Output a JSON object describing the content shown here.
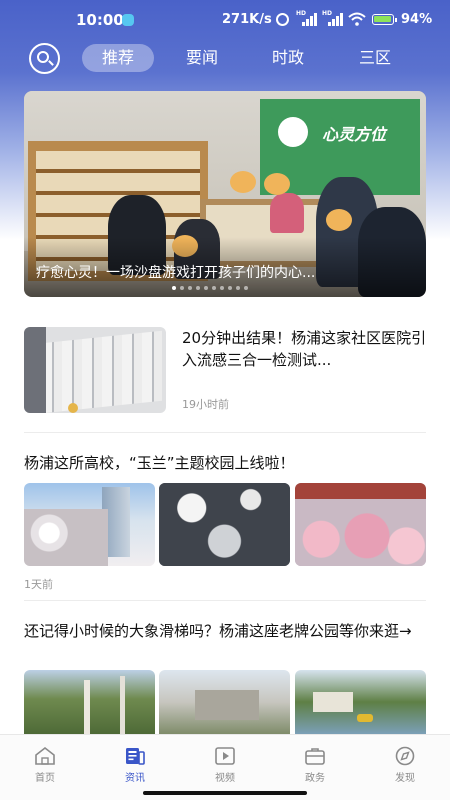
{
  "status_bar": {
    "time": "10:00",
    "network_speed": "271K/s",
    "battery_percent": "94%",
    "signal_label": "HD"
  },
  "top_tabs": [
    {
      "label": "推荐",
      "active": true
    },
    {
      "label": "要闻",
      "active": false
    },
    {
      "label": "时政",
      "active": false
    },
    {
      "label": "三区",
      "active": false
    }
  ],
  "banner": {
    "caption": "疗愈心灵！一场沙盘游戏打开孩子们的内心...",
    "logo_text": "心灵方位",
    "slide_count": 10,
    "current_slide": 1
  },
  "articles": [
    {
      "title": "20分钟出结果！杨浦这家社区医院引入流感三合一检测试...",
      "time": "19小时前"
    },
    {
      "title": "杨浦这所高校，“玉兰”主题校园上线啦！",
      "time": "1天前"
    },
    {
      "title": "还记得小时候的大象滑梯吗？杨浦这座老牌公园等你来逛→"
    }
  ],
  "bottom_nav": [
    {
      "label": "首页",
      "icon": "home-icon",
      "active": false
    },
    {
      "label": "资讯",
      "icon": "news-icon",
      "active": true
    },
    {
      "label": "视频",
      "icon": "video-icon",
      "active": false
    },
    {
      "label": "政务",
      "icon": "briefcase-icon",
      "active": false
    },
    {
      "label": "发现",
      "icon": "compass-icon",
      "active": false
    }
  ],
  "colors": {
    "header_blue": "#4a62c9",
    "active_nav": "#3a56c8",
    "inactive_nav": "#8a8a8a"
  }
}
